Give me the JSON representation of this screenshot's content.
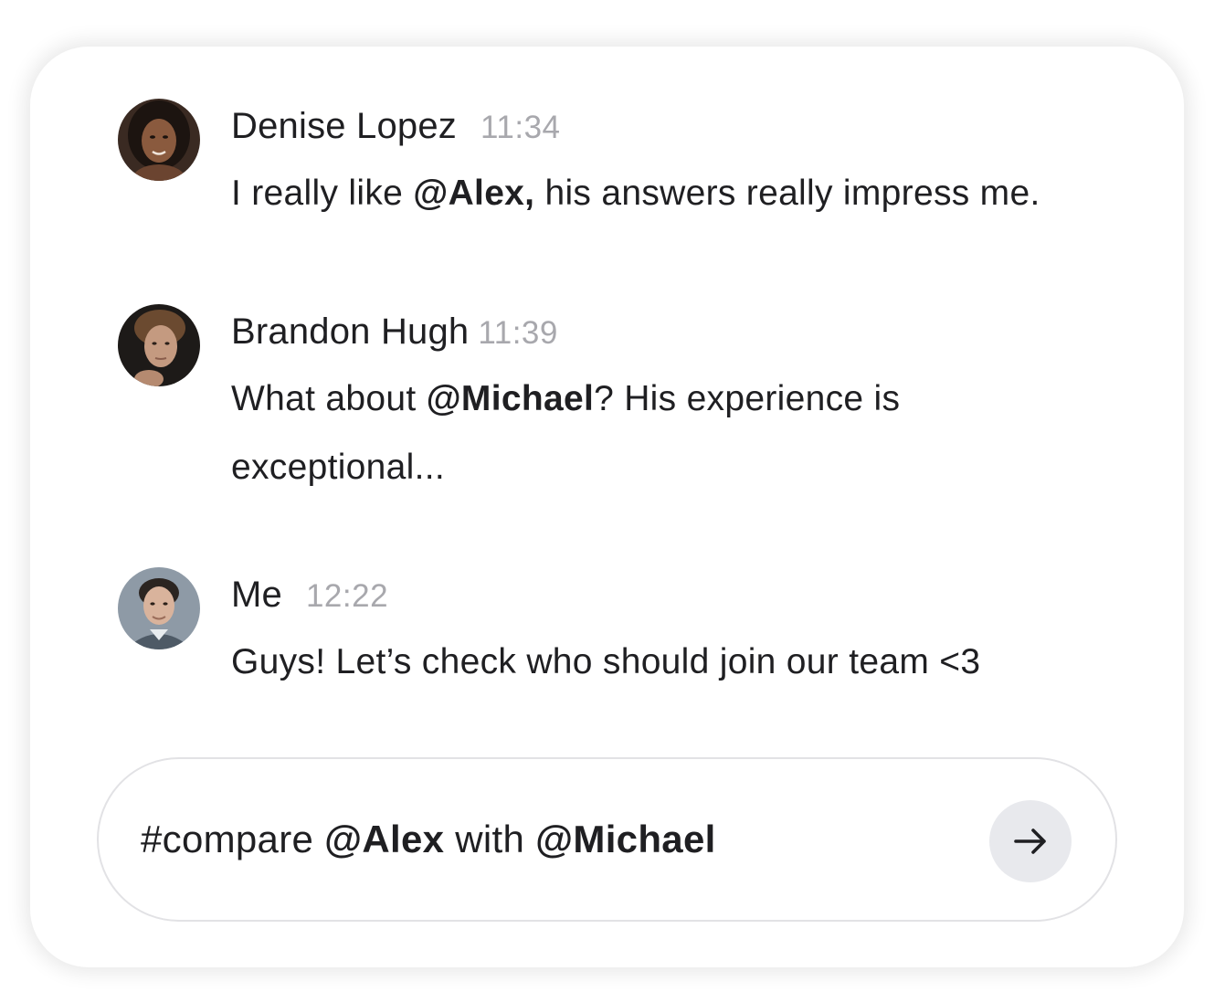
{
  "messages": [
    {
      "author": "Denise Lopez",
      "time": "11:34",
      "text_before": "I really like ",
      "mention": "@Alex,",
      "text_after": " his answers really impress me.",
      "avatar": "avatar-photo"
    },
    {
      "author": "Brandon Hugh",
      "time": "11:39",
      "text_before": "What about ",
      "mention": "@Michael",
      "text_after": "? His experience is",
      "text_line2": "exceptional...",
      "avatar": "avatar-photo"
    },
    {
      "author": "Me",
      "time": "12:22",
      "text": "Guys! Let’s check who should join our team <3",
      "avatar": "avatar-photo"
    }
  ],
  "composer": {
    "tag": "#compare",
    "mention1": "@Alex",
    "connector": " with ",
    "mention2": "@Michael",
    "send_icon": "arrow-right-icon"
  },
  "colors": {
    "text": "#1f1f22",
    "time": "#a8a8ad",
    "composer_border": "#e2e2e5",
    "send_button_bg": "#e8e9ed"
  }
}
